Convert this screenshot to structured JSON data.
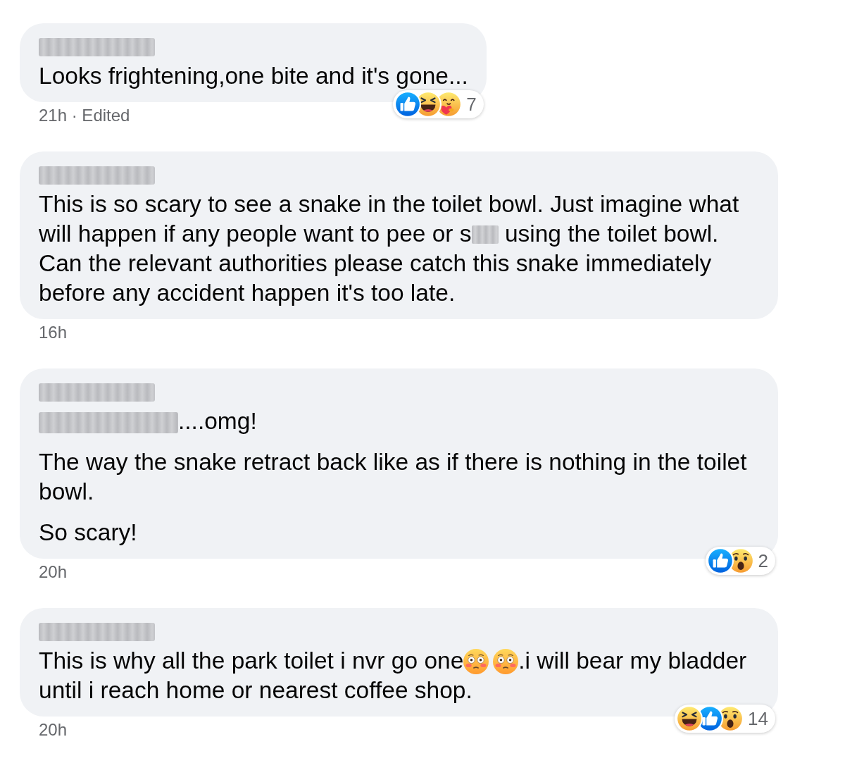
{
  "comments": [
    {
      "paragraphs": [
        [
          {
            "kind": "text",
            "text": "Looks frightening,one bite and it's gone..."
          }
        ]
      ],
      "reactions": {
        "items": [
          {
            "kind": "like"
          },
          {
            "kind": "haha"
          },
          {
            "kind": "care"
          }
        ],
        "count": "7"
      },
      "meta": "21h · Edited"
    },
    {
      "paragraphs": [
        [
          {
            "kind": "text",
            "text": "This is so scary to see a snake in the toilet bowl. Just imagine what will happen if any people want to pee or s"
          },
          {
            "kind": "redacted"
          },
          {
            "kind": "text",
            "text": " using the toilet bowl. Can the relevant authorities please catch this snake immediately before any accident happen it's too late."
          }
        ]
      ],
      "meta": "16h"
    },
    {
      "paragraphs": [
        [
          {
            "kind": "mention"
          },
          {
            "kind": "text",
            "text": "....omg!"
          }
        ],
        [
          {
            "kind": "text",
            "text": "The way the snake retract back like as if there is nothing in the toilet bowl."
          }
        ],
        [
          {
            "kind": "text",
            "text": "So scary!"
          }
        ]
      ],
      "reactions": {
        "items": [
          {
            "kind": "like"
          },
          {
            "kind": "wow"
          }
        ],
        "count": "2"
      },
      "meta": "20h"
    },
    {
      "paragraphs": [
        [
          {
            "kind": "text",
            "text": "This is why all the park toilet i nvr go one"
          },
          {
            "kind": "emoji"
          },
          {
            "kind": "emoji"
          },
          {
            "kind": "text",
            "text": ".i will bear my bladder until i reach home or nearest coffee shop."
          }
        ]
      ],
      "reactions": {
        "items": [
          {
            "kind": "haha"
          },
          {
            "kind": "like"
          },
          {
            "kind": "wow"
          }
        ],
        "count": "14"
      },
      "meta": "20h"
    }
  ]
}
